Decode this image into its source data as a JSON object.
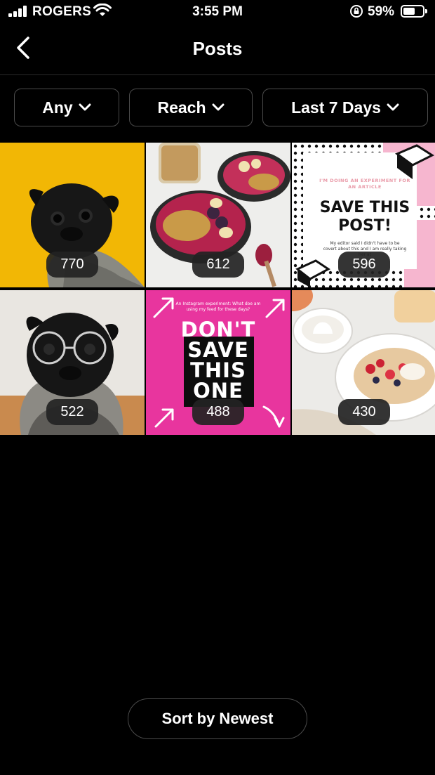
{
  "status_bar": {
    "carrier": "ROGERS",
    "time": "3:55 PM",
    "battery_percent": "59%",
    "battery_level": 0.59
  },
  "header": {
    "title": "Posts",
    "back_icon": "chevron-left-icon"
  },
  "filters": [
    {
      "label": "Any",
      "icon": "chevron-down-icon"
    },
    {
      "label": "Reach",
      "icon": "chevron-down-icon"
    },
    {
      "label": "Last 7 Days",
      "icon": "chevron-down-icon"
    }
  ],
  "posts": [
    {
      "count": "770",
      "subject": "pug on yellow background"
    },
    {
      "count": "612",
      "subject": "smoothie bowls"
    },
    {
      "count": "596",
      "subject": "save this post graphic"
    },
    {
      "count": "522",
      "subject": "pug with glasses"
    },
    {
      "count": "488",
      "subject": "don't save this one graphic"
    },
    {
      "count": "430",
      "subject": "breakfast bowl"
    }
  ],
  "tile_text": {
    "save_small": "I'M DOING AN EXPERIMENT FOR AN ARTICLE",
    "save_big_1": "SAVE THIS",
    "save_big_2": "POST!",
    "save_body": "My editor said I didn't have to be covert about this and I am really taking her at",
    "dont_top": "An Instagram experiment: What doe am using my feed for these days?",
    "dont_1": "DON'T",
    "dont_2": "SAVE",
    "dont_3": "THIS",
    "dont_4": "ONE"
  },
  "sort_button": {
    "label": "Sort by Newest"
  },
  "colors": {
    "background": "#000000",
    "border": "#4a4a4a",
    "tile1_bg": "#F2B705",
    "pink": "#E8359E"
  }
}
